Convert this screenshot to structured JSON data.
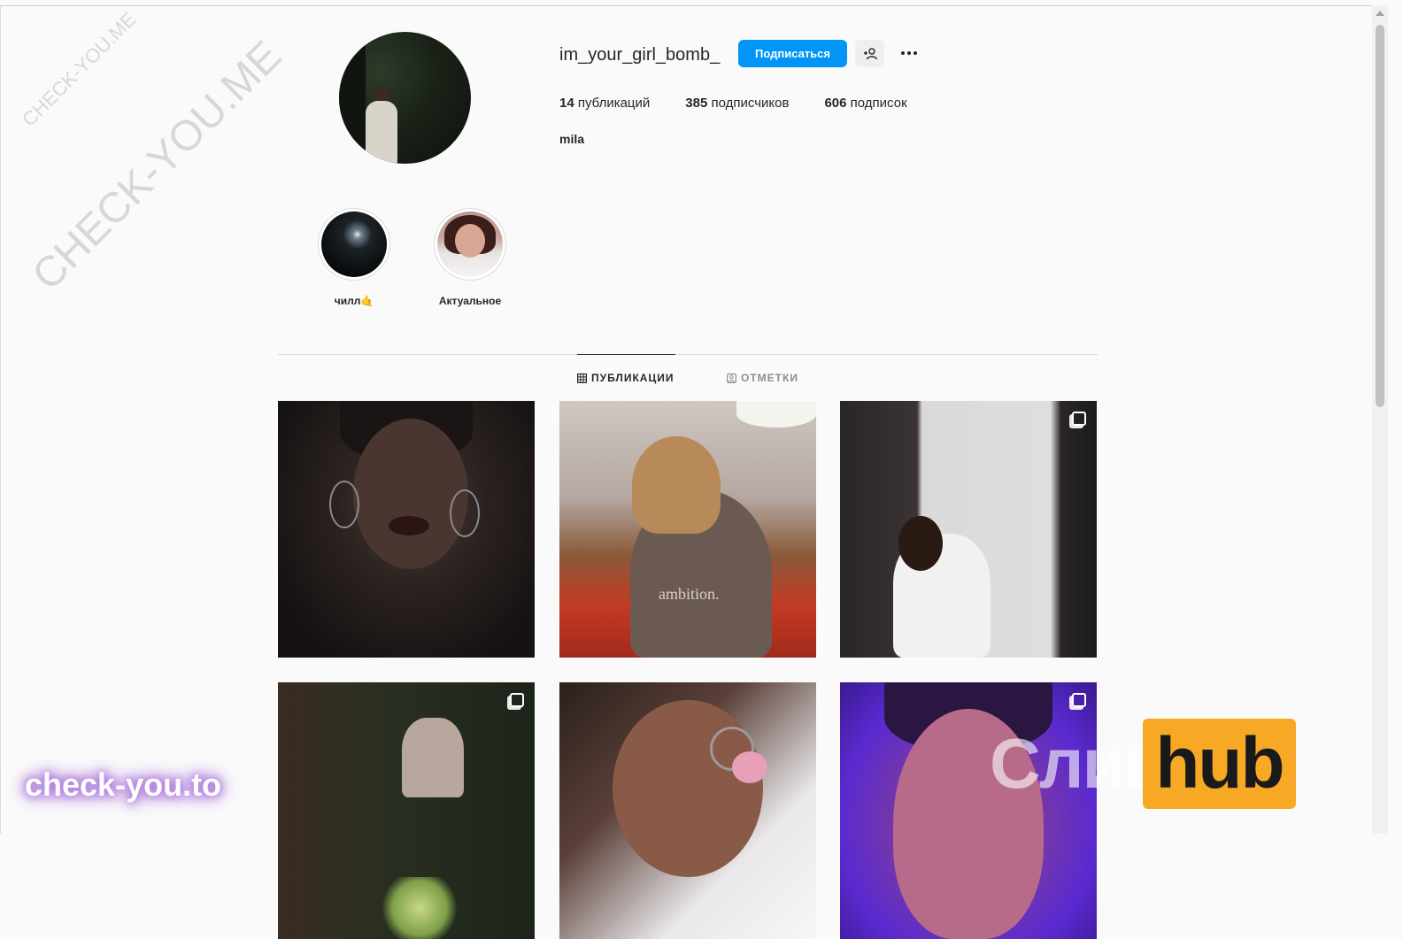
{
  "profile": {
    "username": "im_your_girl_bomb_",
    "follow_label": "Подписаться",
    "full_name": "mila",
    "stats": {
      "posts_count": "14",
      "posts_label": "публикаций",
      "followers_count": "385",
      "followers_label": "подписчиков",
      "following_count": "606",
      "following_label": "подписок"
    }
  },
  "highlights": [
    {
      "label": "чилл🤙"
    },
    {
      "label": "Актуальное"
    }
  ],
  "tabs": [
    {
      "label": "ПУБЛИКАЦИИ",
      "icon": "grid-icon",
      "active": true
    },
    {
      "label": "ОТМЕТКИ",
      "icon": "tagged-icon",
      "active": false
    }
  ],
  "posts": [
    {
      "multi": false
    },
    {
      "multi": false,
      "caption_text": "ambition."
    },
    {
      "multi": true
    },
    {
      "multi": true
    },
    {
      "multi": false
    },
    {
      "multi": true
    }
  ],
  "watermarks": {
    "diag_small": "CHECK-YOU.ME",
    "diag_large": "CHECK-YOU.ME",
    "check_you": "check-you.to",
    "sliv": "Слив",
    "hub": "hub"
  },
  "colors": {
    "accent": "#0095f6",
    "hub_orange": "#f7a825"
  }
}
